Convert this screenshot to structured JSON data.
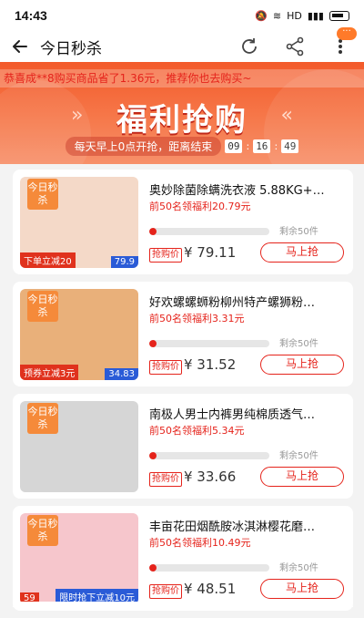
{
  "status": {
    "time": "14:43",
    "network": "HD"
  },
  "header": {
    "title": "今日秒杀",
    "more_badge": "···"
  },
  "banner": {
    "ticker": "恭喜成**8购买商品省了1.36元，推荐你也去购买~",
    "title": "福利抢购",
    "countdown_text": "每天早上0点开抢，距离结束",
    "hours": "09",
    "minutes": "16",
    "seconds": "49"
  },
  "products": [
    {
      "tag": "今日秒杀",
      "name": "奥妙除菌除螨洗衣液 5.88KG+…",
      "desc": "前50名领福利20.79元",
      "progress": 0.06,
      "remaining": "剩余50件",
      "price_label": "抢购价",
      "price": "¥ 79.11",
      "button": "马上抢",
      "thumb_badge": "下单立减20",
      "thumb_badge2": "79.9",
      "thumb_color": "#f4d9c8"
    },
    {
      "tag": "今日秒杀",
      "name": "好欢螺螺蛳粉柳州特产螺狮粉…",
      "desc": "前50名领福利3.31元",
      "progress": 0.06,
      "remaining": "剩余50件",
      "price_label": "抢购价",
      "price": "¥ 31.52",
      "button": "马上抢",
      "thumb_badge": "预券立减3元",
      "thumb_badge2": "34.83",
      "thumb_color": "#e9b07a"
    },
    {
      "tag": "今日秒杀",
      "name": "南极人男士内裤男纯棉质透气…",
      "desc": "前50名领福利5.34元",
      "progress": 0.06,
      "remaining": "剩余50件",
      "price_label": "抢购价",
      "price": "¥ 33.66",
      "button": "马上抢",
      "thumb_badge": "",
      "thumb_badge2": "",
      "thumb_color": "#d6d6d6"
    },
    {
      "tag": "今日秒杀",
      "name": "丰亩花田烟酰胺冰淇淋樱花磨…",
      "desc": "前50名领福利10.49元",
      "progress": 0.06,
      "remaining": "剩余50件",
      "price_label": "抢购价",
      "price": "¥ 48.51",
      "button": "马上抢",
      "thumb_badge": "限时抢下立减10元",
      "thumb_badge2": "59",
      "thumb_color": "#f6c6cc"
    }
  ],
  "colors": {
    "accent": "#e5231b",
    "tag": "#f58a3a",
    "bubble": "#ff7a2a"
  }
}
